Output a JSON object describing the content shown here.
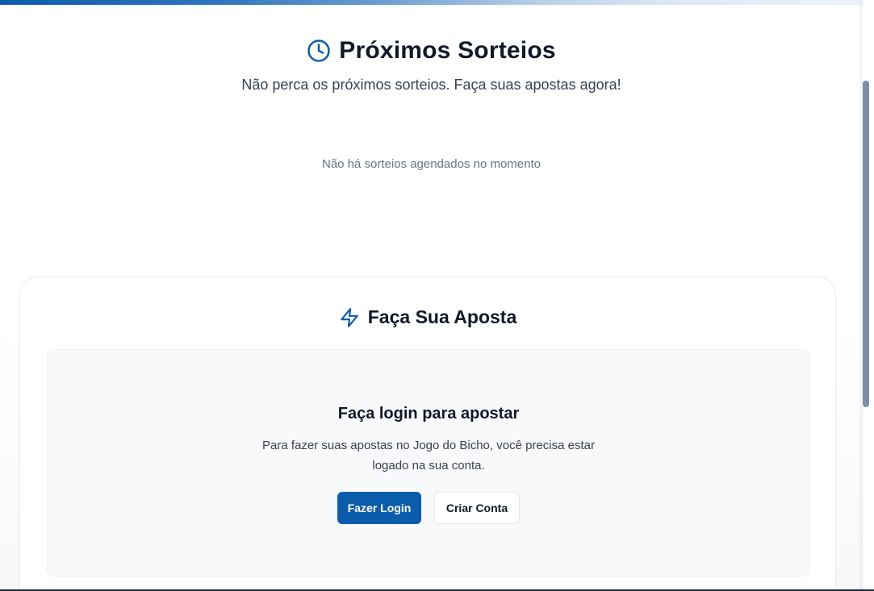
{
  "colors": {
    "accent": "#0b5cab",
    "heading": "#111827",
    "muted": "#6b7280",
    "panel_bg": "#f8f9fb"
  },
  "upcoming": {
    "icon": "clock-icon",
    "title": "Próximos Sorteios",
    "subtitle": "Não perca os próximos sorteios. Faça suas apostas agora!",
    "empty_message": "Não há sorteios agendados no momento"
  },
  "bet": {
    "icon": "lightning-icon",
    "title": "Faça Sua Aposta",
    "login_prompt": {
      "heading": "Faça login para apostar",
      "text": "Para fazer suas apostas no Jogo do Bicho, você precisa estar logado na sua conta.",
      "login_button": "Fazer Login",
      "signup_button": "Criar Conta"
    }
  }
}
